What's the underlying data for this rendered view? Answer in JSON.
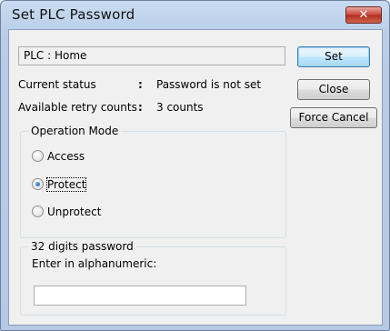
{
  "window": {
    "title": "Set PLC Password",
    "close_glyph": "✕"
  },
  "plc": {
    "text": "PLC  :  Home"
  },
  "status": {
    "current_label": "Current status",
    "current_sep": ":",
    "current_value": "Password is not set",
    "retry_label": "Available retry counts",
    "retry_sep": ":",
    "retry_value": "3 counts"
  },
  "buttons": {
    "set": "Set",
    "close": "Close",
    "force_cancel": "Force Cancel"
  },
  "operation_mode": {
    "title": "Operation Mode",
    "options": [
      {
        "label": "Access",
        "checked": false
      },
      {
        "label": "Protect",
        "checked": true
      },
      {
        "label": "Unprotect",
        "checked": false
      }
    ]
  },
  "password": {
    "group_title": "32 digits password",
    "instruction": "Enter in alphanumeric:",
    "value": ""
  },
  "icons": {
    "close": "close-icon",
    "radio": "radio-button-icon"
  },
  "colors": {
    "title_bar": "#b9cfe9",
    "close_button": "#c7443a",
    "default_button_border": "#3c7fb1",
    "client_background": "#f0f0f0"
  }
}
